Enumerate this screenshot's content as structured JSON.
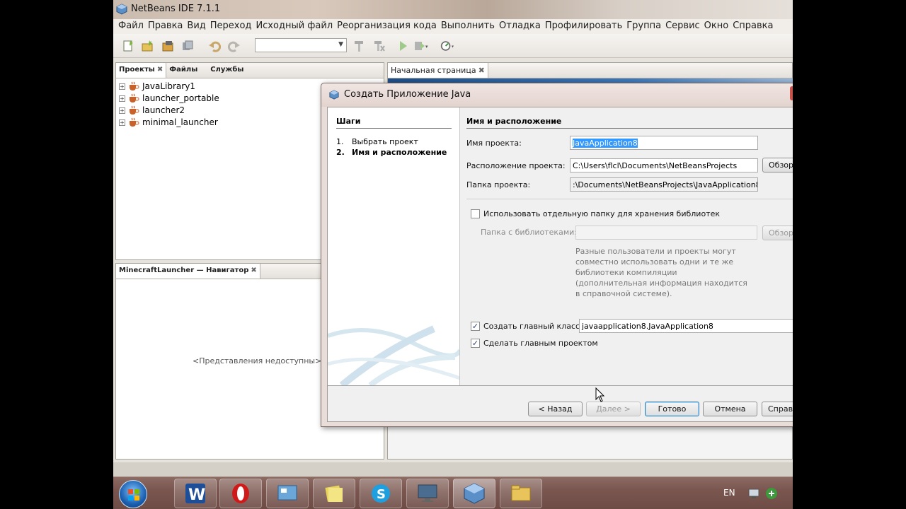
{
  "window": {
    "title": "NetBeans IDE 7.1.1"
  },
  "menu": [
    "Файл",
    "Правка",
    "Вид",
    "Переход",
    "Исходный файл",
    "Реорганизация кода",
    "Выполнить",
    "Отладка",
    "Профилировать",
    "Группа",
    "Сервис",
    "Окно",
    "Справка"
  ],
  "projects_panel": {
    "tabs": [
      "Проекты",
      "Файлы",
      "Службы"
    ],
    "items": [
      "JavaLibrary1",
      "launcher_portable",
      "launcher2",
      "minimal_launcher"
    ]
  },
  "navigator_panel": {
    "tab": "MinecraftLauncher — Навигатор",
    "empty_text": "<Представления недоступны>"
  },
  "editor": {
    "tab": "Начальная страница"
  },
  "dialog": {
    "title": "Создать Приложение Java",
    "steps_title": "Шаги",
    "steps": [
      {
        "num": "1.",
        "label": "Выбрать проект"
      },
      {
        "num": "2.",
        "label": "Имя и расположение"
      }
    ],
    "section_title": "Имя и расположение",
    "project_name_label": "Имя проекта:",
    "project_name_value": "JavaApplication8",
    "project_location_label": "Расположение проекта:",
    "project_location_value": "C:\\Users\\flcl\\Documents\\NetBeansProjects",
    "browse_label": "Обзор...",
    "project_folder_label": "Папка проекта:",
    "project_folder_value": ":\\Documents\\NetBeansProjects\\JavaApplication8",
    "separate_libs_label": "Использовать отдельную папку для хранения библиотек",
    "separate_libs_checked": false,
    "libs_folder_label": "Папка с библиотеками:",
    "libs_folder_value": "",
    "libs_browse_label": "Обзор...",
    "info_text": "Разные пользователи и проекты могут совместно использовать одни и те же библиотеки компиляции (дополнительная информация находится в справочной системе).",
    "create_main_label": "Создать главный класс",
    "create_main_checked": true,
    "main_class_value": "javaapplication8.JavaApplication8",
    "set_main_label": "Сделать главным проектом",
    "set_main_checked": true,
    "buttons": {
      "back": "< Назад",
      "next": "Далее >",
      "finish": "Готово",
      "cancel": "Отмена",
      "help": "Справка"
    }
  },
  "taskbar": {
    "language": "EN"
  }
}
